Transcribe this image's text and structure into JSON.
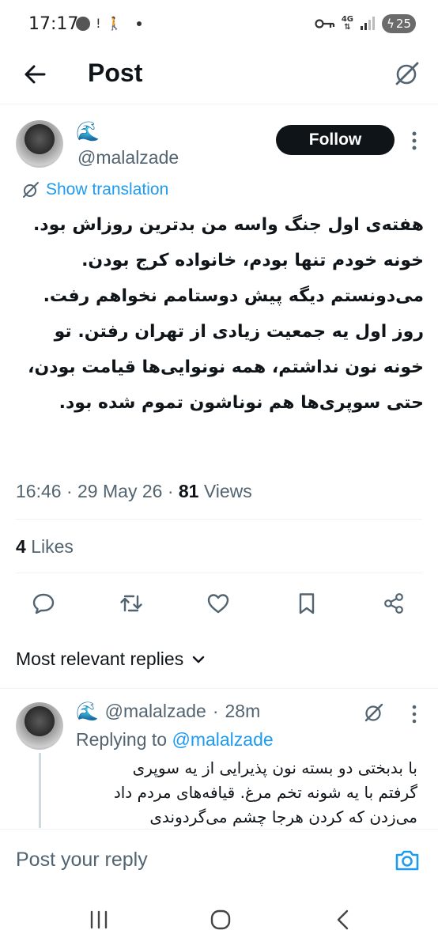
{
  "status_bar": {
    "time": "17:17",
    "network": "4G",
    "battery": "25"
  },
  "header": {
    "title": "Post"
  },
  "tweet": {
    "author_emoji": "🌊",
    "handle": "@malalzade",
    "follow_label": "Follow",
    "translation_label": "Show translation",
    "lines": [
      "هفته‌ی اول جنگ واسه من بدترین روزاش بود.",
      "خونه خودم تنها بودم، خانواده کرج بودن.",
      "می‌دونستم دیگه پیش دوستامم نخواهم رفت.",
      "روز اول یه جمعیت زیادی از تهران رفتن. تو",
      "خونه نون نداشتم، همه نونوایی‌ها قیامت بودن،",
      "حتی سوپری‌ها هم نوناشون تموم شده بود."
    ],
    "time": "16:46",
    "date": "29 May 26",
    "views_count": "81",
    "views_label": "Views",
    "likes_count": "4",
    "likes_label": "Likes"
  },
  "replies_filter": {
    "label": "Most relevant replies"
  },
  "reply": {
    "author_emoji": "🌊",
    "handle": "@malalzade",
    "age": "28m",
    "replying_prefix": "Replying to",
    "replying_to": "@malalzade",
    "lines": [
      "با بدبختی دو بسته نون پذیرایی از یه سوپری",
      "گرفتم با یه شونه تخم مرغ. قیافه‌های مردم داد",
      "می‌زدن که کردن هرجا چشم می‌گردوندی"
    ]
  },
  "reply_bar": {
    "placeholder": "Post your reply"
  },
  "colors": {
    "accent": "#1d9bf0",
    "text": "#0f1419",
    "secondary": "#536471"
  },
  "icons": {
    "back": "arrow-left-icon",
    "grok": "grok-icon",
    "reply": "reply-bubble-icon",
    "repost": "repost-icon",
    "like": "heart-icon",
    "bookmark": "bookmark-icon",
    "share": "share-icon",
    "camera": "camera-icon"
  }
}
